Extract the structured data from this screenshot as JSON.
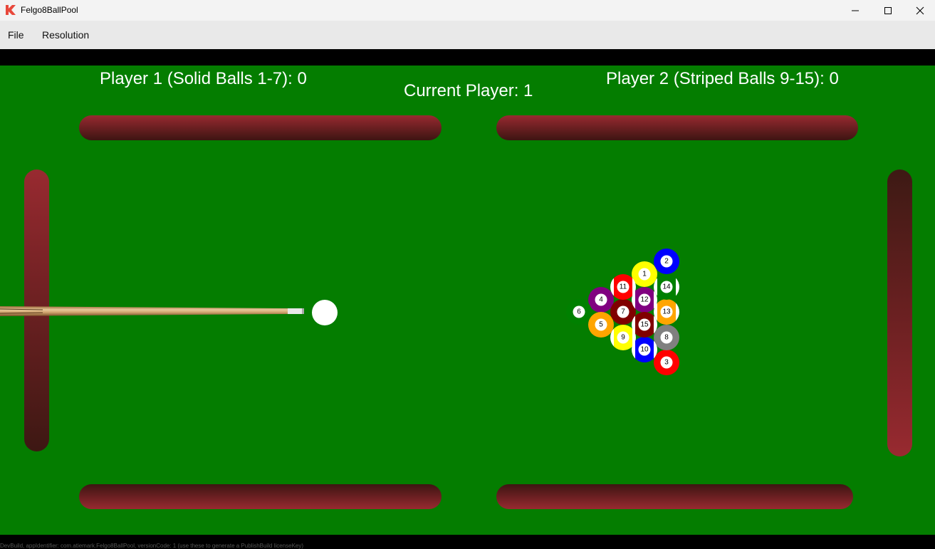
{
  "window": {
    "title": "Felgo8BallPool",
    "controls": [
      "minimize-icon",
      "maximize-icon",
      "close-icon"
    ]
  },
  "menu": {
    "items": [
      {
        "id": "file",
        "label": "File"
      },
      {
        "id": "resolution",
        "label": "Resolution"
      }
    ]
  },
  "hud": {
    "player1": "Player 1 (Solid Balls 1-7): 0",
    "player2": "Player 2 (Striped Balls 9-15): 0",
    "current": "Current Player: 1"
  },
  "game": {
    "colors": {
      "felt": "#047d00",
      "rail": "#982a30",
      "cue_ball": "#ffffff"
    },
    "balls": [
      {
        "number": "1",
        "color": "#ffff00",
        "style": "solid"
      },
      {
        "number": "2",
        "color": "#0000ff",
        "style": "solid"
      },
      {
        "number": "3",
        "color": "#ff0000",
        "style": "solid"
      },
      {
        "number": "4",
        "color": "#800080",
        "style": "solid"
      },
      {
        "number": "5",
        "color": "#ffa500",
        "style": "solid"
      },
      {
        "number": "6",
        "color": "#008000",
        "style": "solid"
      },
      {
        "number": "7",
        "color": "#800000",
        "style": "solid"
      },
      {
        "number": "8",
        "color": "#808080",
        "style": "solid"
      },
      {
        "number": "9",
        "color": "#ffff00",
        "style": "striped"
      },
      {
        "number": "10",
        "color": "#0000ff",
        "style": "striped"
      },
      {
        "number": "11",
        "color": "#ff0000",
        "style": "striped"
      },
      {
        "number": "12",
        "color": "#800080",
        "style": "striped"
      },
      {
        "number": "13",
        "color": "#ffa500",
        "style": "striped"
      },
      {
        "number": "14",
        "color": "#008000",
        "style": "striped"
      },
      {
        "number": "15",
        "color": "#800000",
        "style": "striped"
      }
    ]
  },
  "footer": {
    "text": "DevBuild, appIdentifier: com.atiemark.Felgo8BallPool, versionCode: 1 (use these to generate a PublishBuild licenseKey)"
  }
}
